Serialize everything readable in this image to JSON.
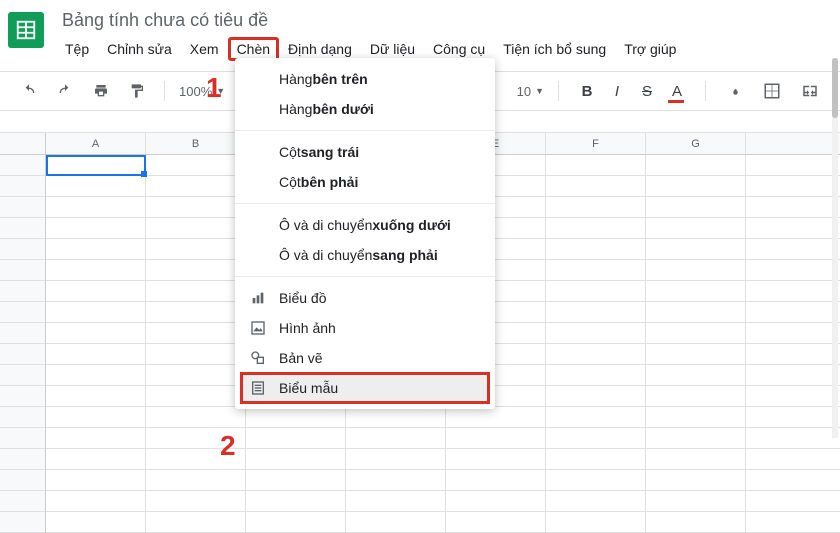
{
  "doc": {
    "title": "Bảng tính chưa có tiêu đề"
  },
  "menubar": {
    "file": "Tệp",
    "edit": "Chỉnh sửa",
    "view": "Xem",
    "insert": "Chèn",
    "format": "Định dạng",
    "data": "Dữ liệu",
    "tools": "Công cụ",
    "addons": "Tiện ích bổ sung",
    "help": "Trợ giúp"
  },
  "annotations": {
    "one": "1",
    "two": "2"
  },
  "toolbar": {
    "zoom": "100%",
    "font_size": "10",
    "bold": "B",
    "italic": "I",
    "strike": "S",
    "textcolor": "A"
  },
  "columns": [
    "A",
    "B",
    "",
    "",
    "E",
    "F",
    "G",
    ""
  ],
  "dropdown": {
    "row_above_pre": "Hàng ",
    "row_above_bold": "bên trên",
    "row_below_pre": "Hàng ",
    "row_below_bold": "bên dưới",
    "col_left_pre": "Cột ",
    "col_left_bold": "sang trái",
    "col_right_pre": "Cột ",
    "col_right_bold": "bên phải",
    "cells_down_pre": "Ô và di chuyển ",
    "cells_down_bold": "xuống dưới",
    "cells_right_pre": "Ô và di chuyển ",
    "cells_right_bold": "sang phải",
    "chart": "Biểu đồ",
    "image": "Hình ảnh",
    "drawing": "Bản vẽ",
    "form": "Biểu mẫu"
  }
}
